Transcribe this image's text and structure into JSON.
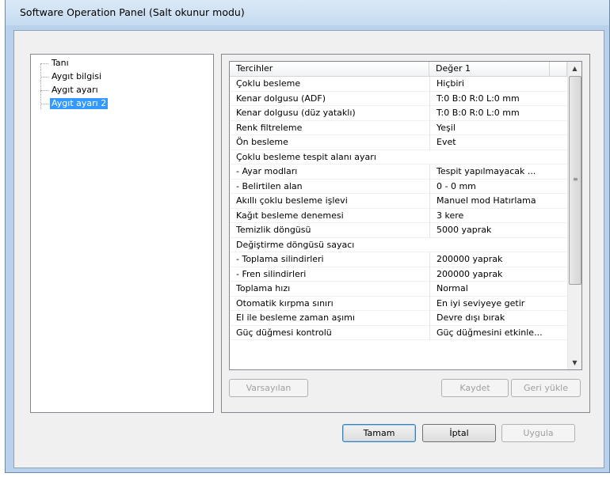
{
  "window": {
    "title": "Software Operation Panel (Salt okunur modu)"
  },
  "tree": {
    "items": [
      {
        "label": "Tanı",
        "selected": false
      },
      {
        "label": "Aygıt bilgisi",
        "selected": false
      },
      {
        "label": "Aygıt ayarı",
        "selected": false
      },
      {
        "label": "Aygıt ayarı 2",
        "selected": true
      }
    ]
  },
  "list": {
    "headers": [
      "Tercihler",
      "Değer 1"
    ],
    "rows": [
      [
        "Çoklu besleme",
        "Hiçbiri"
      ],
      [
        "Kenar dolgusu (ADF)",
        "T:0 B:0 R:0 L:0 mm"
      ],
      [
        "Kenar dolgusu (düz yataklı)",
        "T:0 B:0 R:0 L:0 mm"
      ],
      [
        "Renk filtreleme",
        "Yeşil"
      ],
      [
        "Ön besleme",
        "Evet"
      ],
      [
        "Çoklu besleme tespit alanı ayarı",
        ""
      ],
      [
        " - Ayar modları",
        "Tespit yapılmayacak ..."
      ],
      [
        " - Belirtilen alan",
        "0 - 0 mm"
      ],
      [
        "Akıllı çoklu besleme işlevi",
        "Manuel mod  Hatırlama"
      ],
      [
        "Kağıt besleme denemesi",
        "3 kere"
      ],
      [
        "Temizlik döngüsü",
        "5000 yaprak"
      ],
      [
        "Değiştirme döngüsü sayacı",
        ""
      ],
      [
        " - Toplama silindirleri",
        "200000 yaprak"
      ],
      [
        " - Fren silindirleri",
        "200000 yaprak"
      ],
      [
        "Toplama hızı",
        "Normal"
      ],
      [
        "Otomatik kırpma sınırı",
        "En iyi seviyeye getir"
      ],
      [
        "El ile besleme zaman aşımı",
        "Devre dışı bırak"
      ],
      [
        "Güç düğmesi kontrolü",
        "Güç düğmesini etkinle..."
      ]
    ]
  },
  "buttons": {
    "defaults": "Varsayılan",
    "save": "Kaydet",
    "restore": "Geri yükle",
    "ok": "Tamam",
    "cancel": "İptal",
    "apply": "Uygula"
  },
  "icons": {
    "scroll_up": "▲",
    "scroll_down": "▼",
    "scroll_grip": "≡"
  }
}
